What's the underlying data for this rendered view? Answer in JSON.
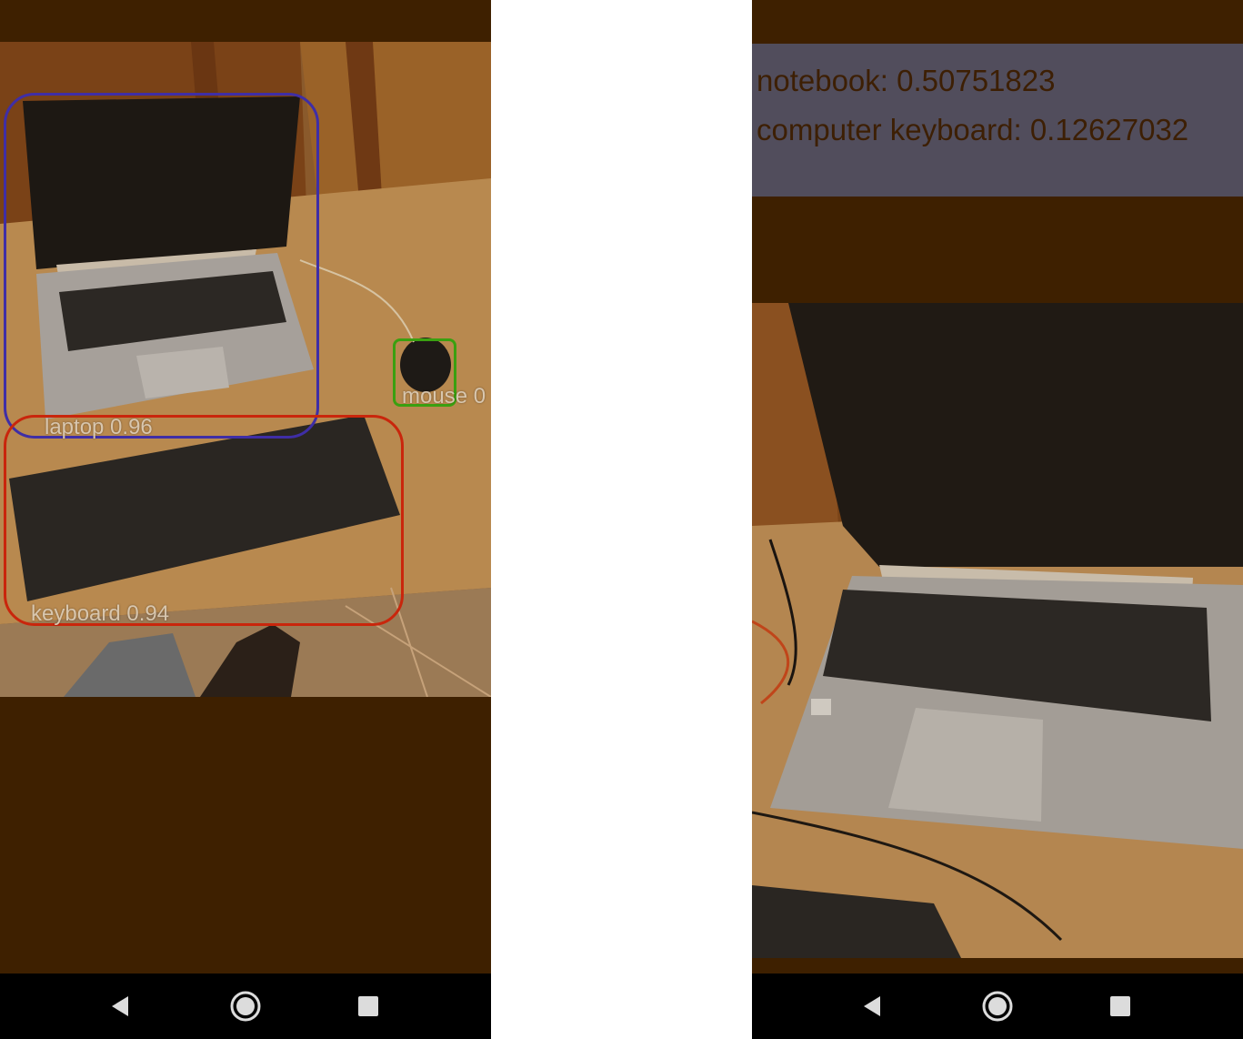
{
  "left_screen": {
    "detections": [
      {
        "label": "laptop 0.96",
        "color": "#3f2ea6"
      },
      {
        "label": "keyboard 0.94",
        "color": "#c9260c"
      },
      {
        "label": "mouse 0",
        "color": "#3aa010"
      }
    ]
  },
  "right_screen": {
    "results": [
      {
        "text": "notebook: 0.50751823"
      },
      {
        "text": "computer keyboard: 0.12627032"
      }
    ]
  },
  "nav": {
    "back_icon": "back-triangle-icon",
    "home_icon": "home-circle-icon",
    "recents_icon": "recents-square-icon"
  },
  "colors": {
    "overlay_brown": "#3e2000",
    "results_panel": "#514d5c",
    "label_text": "#d8c6ae",
    "result_text": "#3d1f04"
  }
}
